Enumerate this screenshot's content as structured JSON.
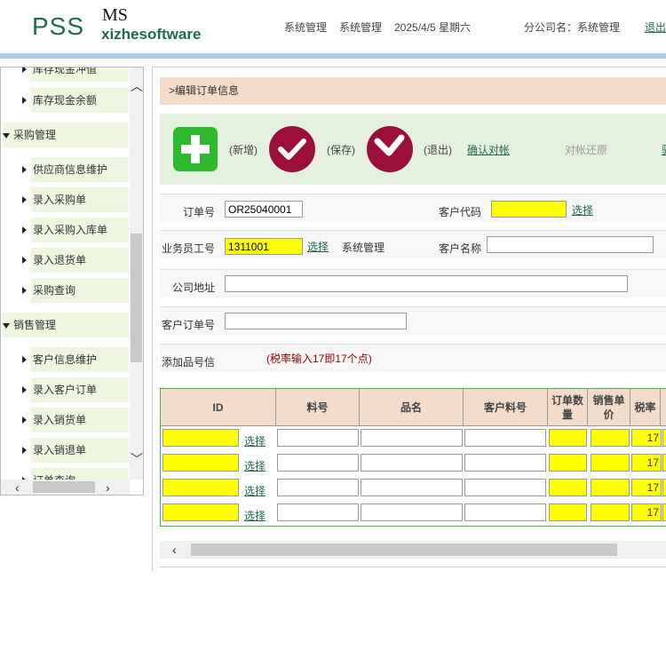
{
  "header": {
    "logo_main": "PSS",
    "logo_ms": "MS",
    "logo_sub": "xizhesoftware",
    "nav1": "系统管理",
    "nav2": "系统管理",
    "date": "2025/4/5 星期六",
    "company": "分公司名：系统管理",
    "logout": "退出"
  },
  "sidebar": {
    "items": [
      {
        "label": "库存现金冲值",
        "type": "sub"
      },
      {
        "label": "库存现金余额",
        "type": "sub"
      },
      {
        "label": "采购管理",
        "type": "group"
      },
      {
        "label": "供应商信息维护",
        "type": "sub"
      },
      {
        "label": "录入采购单",
        "type": "sub"
      },
      {
        "label": "录入采购入库单",
        "type": "sub"
      },
      {
        "label": "录入退货单",
        "type": "sub"
      },
      {
        "label": "采购查询",
        "type": "sub"
      },
      {
        "label": "销售管理",
        "type": "group"
      },
      {
        "label": "客户信息维护",
        "type": "sub"
      },
      {
        "label": "录入客户订单",
        "type": "sub"
      },
      {
        "label": "录入销货单",
        "type": "sub"
      },
      {
        "label": "录入销退单",
        "type": "sub"
      },
      {
        "label": "订单查询",
        "type": "sub"
      }
    ]
  },
  "main": {
    "title": ">编辑订单信息",
    "toolbar": {
      "add_label": "(新增)",
      "save_label": "(保存)",
      "exit_label": "(退出)",
      "confirm_link": "确认对帐",
      "restore_link": "对帐还原",
      "extra_link": "驱"
    },
    "form": {
      "order_no_label": "订单号",
      "order_no_value": "OR25040001",
      "customer_code_label": "客户代码",
      "customer_code_value": "",
      "select_label": "选择",
      "staff_no_label": "业务员工号",
      "staff_no_value": "1311001",
      "staff_name": "系统管理",
      "customer_name_label": "客户名称",
      "customer_name_value": "",
      "address_label": "公司地址",
      "address_value": "",
      "cust_order_label": "客户订单号",
      "cust_order_value": "",
      "add_item_label": "添加品号信",
      "tax_note": "(税率输入17即17个点)"
    },
    "grid": {
      "headers": [
        "ID",
        "料号",
        "品名",
        "客户料号",
        "订单数量",
        "销售单价",
        "税率"
      ],
      "select_label": "选择",
      "rows": [
        {
          "tax": "17"
        },
        {
          "tax": "17"
        },
        {
          "tax": "17"
        },
        {
          "tax": "17"
        }
      ]
    }
  },
  "colors": {
    "brand_green": "#1f6b4a",
    "header_bar": "#a9cff0",
    "highlight_yellow": "#ffff00",
    "add_button": "#2db82d",
    "save_button": "#9b0f3a"
  }
}
